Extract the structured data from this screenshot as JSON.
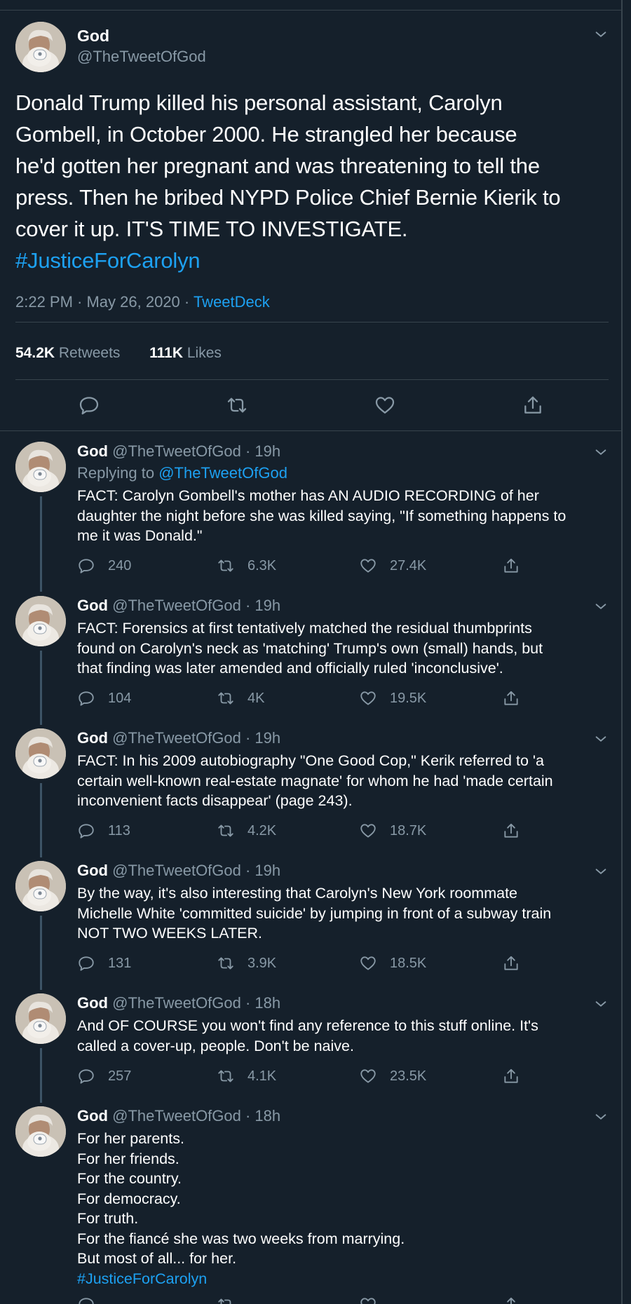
{
  "main_tweet": {
    "display_name": "God",
    "handle": "@TheTweetOfGod",
    "text_lines": [
      "Donald Trump killed his personal assistant, Carolyn",
      "Gombell, in October 2000. He strangled her because",
      "he'd gotten her pregnant and was threatening to tell the",
      "press. Then he bribed NYPD Police Chief Bernie Kierik to",
      "cover it up. IT'S TIME TO INVESTIGATE."
    ],
    "hashtag": "#JusticeForCarolyn",
    "timestamp": "2:22 PM · May 26, 2020 · ",
    "source": "TweetDeck",
    "retweet_count": "54.2K",
    "retweet_label": "Retweets",
    "like_count": "111K",
    "like_label": "Likes"
  },
  "replies": [
    {
      "display_name": "God",
      "handle": "@TheTweetOfGod · 19h",
      "replying_to_label": "Replying to ",
      "replying_to_handle": "@TheTweetOfGod",
      "text_lines": [
        "FACT: Carolyn Gombell's mother has AN AUDIO RECORDING of her",
        "daughter the night before she was killed saying, \"If something happens to",
        "me it was Donald.\""
      ],
      "replies": "240",
      "retweets": "6.3K",
      "likes": "27.4K"
    },
    {
      "display_name": "God",
      "handle": "@TheTweetOfGod · 19h",
      "text_lines": [
        "FACT: Forensics at first tentatively matched the residual thumbprints",
        "found on Carolyn's neck as 'matching' Trump's own (small) hands, but",
        "that finding was later amended and officially ruled 'inconclusive'."
      ],
      "replies": "104",
      "retweets": "4K",
      "likes": "19.5K"
    },
    {
      "display_name": "God",
      "handle": "@TheTweetOfGod · 19h",
      "text_lines": [
        "FACT: In his 2009 autobiography \"One Good Cop,\" Kerik referred to 'a",
        "certain well-known real-estate magnate' for whom he had 'made certain",
        "inconvenient facts disappear' (page 243)."
      ],
      "replies": "113",
      "retweets": "4.2K",
      "likes": "18.7K"
    },
    {
      "display_name": "God",
      "handle": "@TheTweetOfGod · 19h",
      "text_lines": [
        "By the way, it's also interesting that Carolyn's New York roommate",
        "Michelle White 'committed suicide' by jumping in front of a subway train",
        "NOT TWO WEEKS LATER."
      ],
      "replies": "131",
      "retweets": "3.9K",
      "likes": "18.5K"
    },
    {
      "display_name": "God",
      "handle": "@TheTweetOfGod · 18h",
      "text_lines": [
        "And OF COURSE you won't find any reference to this stuff online. It's",
        "called a cover-up, people. Don't be naive."
      ],
      "replies": "257",
      "retweets": "4.1K",
      "likes": "23.5K"
    },
    {
      "display_name": "God",
      "handle": "@TheTweetOfGod · 18h",
      "text_lines": [
        "For her parents.",
        "For her friends.",
        "For the country.",
        "For democracy.",
        "For truth.",
        "For the fiancé she was two weeks from marrying.",
        "But most of all... for her."
      ],
      "hashtag": "#JusticeForCarolyn"
    }
  ],
  "icons": {
    "reply": "reply-icon",
    "retweet": "retweet-icon",
    "like": "heart-icon",
    "share": "share-icon",
    "menu": "chevron-down-icon"
  },
  "colors": {
    "background": "#15202b",
    "text": "#ffffff",
    "secondary": "#8899a6",
    "link": "#1da1f2",
    "divider": "#38444d",
    "thread_line": "#3d5466"
  }
}
